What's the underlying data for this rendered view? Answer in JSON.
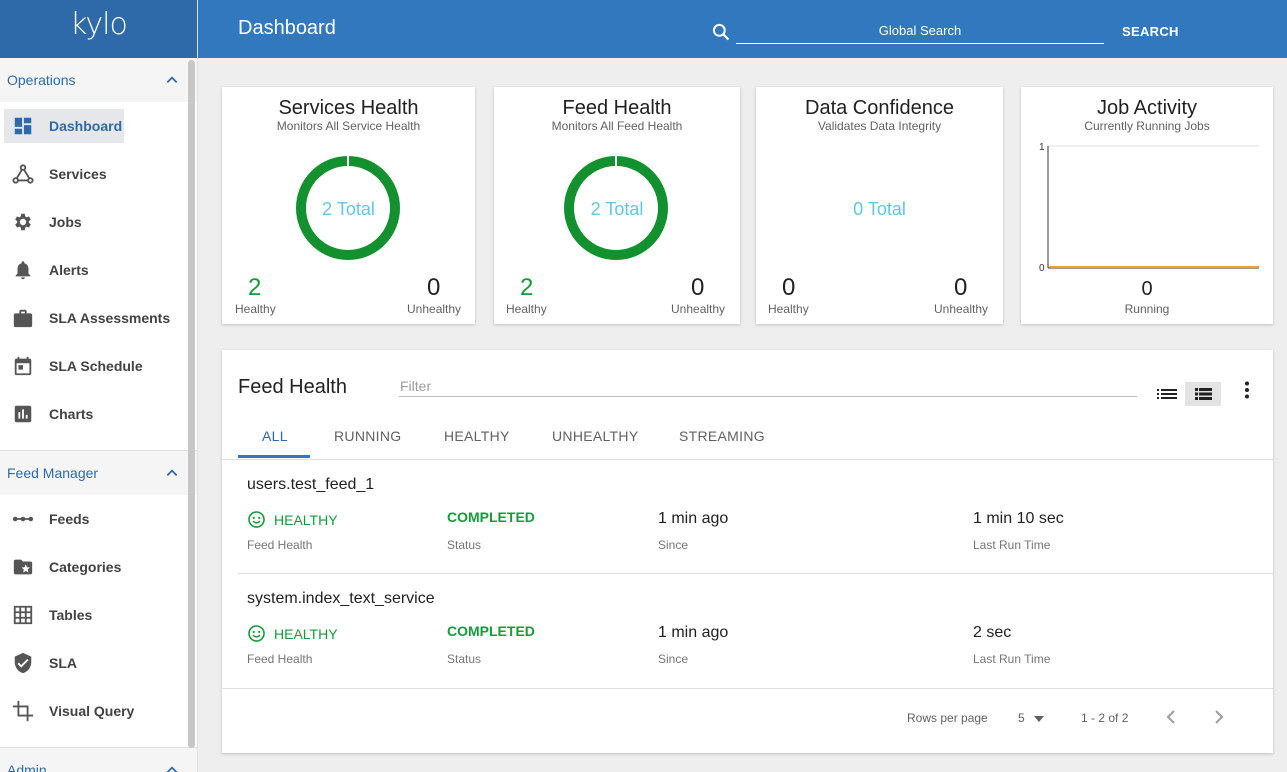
{
  "app": {
    "logo": "kylo"
  },
  "header": {
    "title": "Dashboard",
    "search_placeholder": "Global Search",
    "search_button": "SEARCH"
  },
  "sidebar": {
    "operations": {
      "label": "Operations",
      "items": [
        {
          "label": "Dashboard",
          "icon": "dashboard-icon"
        },
        {
          "label": "Services",
          "icon": "network-icon"
        },
        {
          "label": "Jobs",
          "icon": "gear-icon"
        },
        {
          "label": "Alerts",
          "icon": "bell-icon"
        },
        {
          "label": "SLA Assessments",
          "icon": "briefcase-icon"
        },
        {
          "label": "SLA Schedule",
          "icon": "calendar-icon"
        },
        {
          "label": "Charts",
          "icon": "chart-icon"
        }
      ]
    },
    "feed_manager": {
      "label": "Feed Manager",
      "items": [
        {
          "label": "Feeds",
          "icon": "linear-scale-icon"
        },
        {
          "label": "Categories",
          "icon": "folder-star-icon"
        },
        {
          "label": "Tables",
          "icon": "grid-icon"
        },
        {
          "label": "SLA",
          "icon": "verified-shield-icon"
        },
        {
          "label": "Visual Query",
          "icon": "crop-icon"
        }
      ]
    },
    "admin": {
      "label": "Admin"
    }
  },
  "cards": {
    "services": {
      "title": "Services Health",
      "subtitle": "Monitors All Service Health",
      "total": "2 Total",
      "healthy": "2",
      "healthy_label": "Healthy",
      "unhealthy": "0",
      "unhealthy_label": "Unhealthy"
    },
    "feeds": {
      "title": "Feed Health",
      "subtitle": "Monitors All Feed Health",
      "total": "2 Total",
      "healthy": "2",
      "healthy_label": "Healthy",
      "unhealthy": "0",
      "unhealthy_label": "Unhealthy"
    },
    "confidence": {
      "title": "Data Confidence",
      "subtitle": "Validates Data Integrity",
      "total": "0 Total",
      "healthy": "0",
      "healthy_label": "Healthy",
      "unhealthy": "0",
      "unhealthy_label": "Unhealthy"
    },
    "jobs": {
      "title": "Job Activity",
      "subtitle": "Currently Running Jobs",
      "y_max": "1",
      "y_min": "0",
      "running": "0",
      "running_label": "Running"
    }
  },
  "feed_health": {
    "title": "Feed Health",
    "filter_placeholder": "Filter",
    "tabs": [
      "ALL",
      "RUNNING",
      "HEALTHY",
      "UNHEALTHY",
      "STREAMING"
    ],
    "rows": [
      {
        "name": "users.test_feed_1",
        "health": "HEALTHY",
        "health_label": "Feed Health",
        "status": "COMPLETED",
        "status_label": "Status",
        "since": "1 min ago",
        "since_label": "Since",
        "last_run": "1 min 10 sec",
        "last_run_label": "Last Run Time"
      },
      {
        "name": "system.index_text_service",
        "health": "HEALTHY",
        "health_label": "Feed Health",
        "status": "COMPLETED",
        "status_label": "Status",
        "since": "1 min ago",
        "since_label": "Since",
        "last_run": "2 sec",
        "last_run_label": "Last Run Time"
      }
    ],
    "pager": {
      "rows_per_page_label": "Rows per page",
      "rows_per_page": "5",
      "range": "1 - 2 of 2"
    }
  },
  "colors": {
    "primary": "#3178bf",
    "healthy": "#149c3a",
    "total": "#5fc8e6",
    "job_line": "#f2a02c"
  }
}
